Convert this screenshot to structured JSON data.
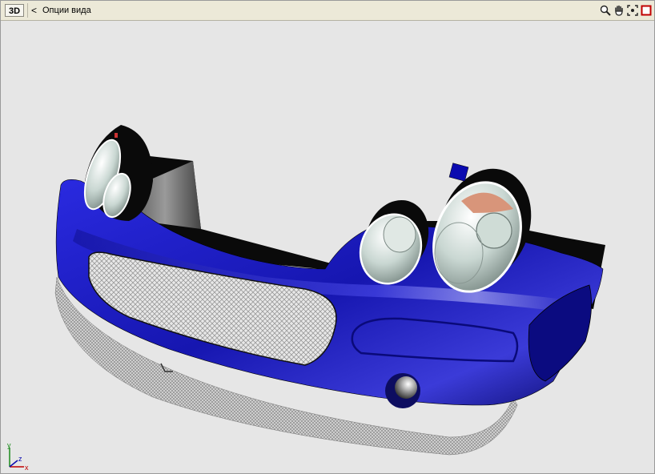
{
  "toolbar": {
    "mode_label": "3D",
    "back_glyph": "<",
    "title": "Опции вида",
    "tools": [
      {
        "name": "zoom-icon"
      },
      {
        "name": "pan-hand-icon"
      },
      {
        "name": "zoom-extents-icon"
      },
      {
        "name": "maximize-window-icon"
      }
    ]
  },
  "viewport": {
    "background_color": "#e6e6e6",
    "model": "front-bumper",
    "model_color": "#1e1ec8",
    "axes": {
      "y": "y",
      "z": "z",
      "x": "x"
    }
  }
}
